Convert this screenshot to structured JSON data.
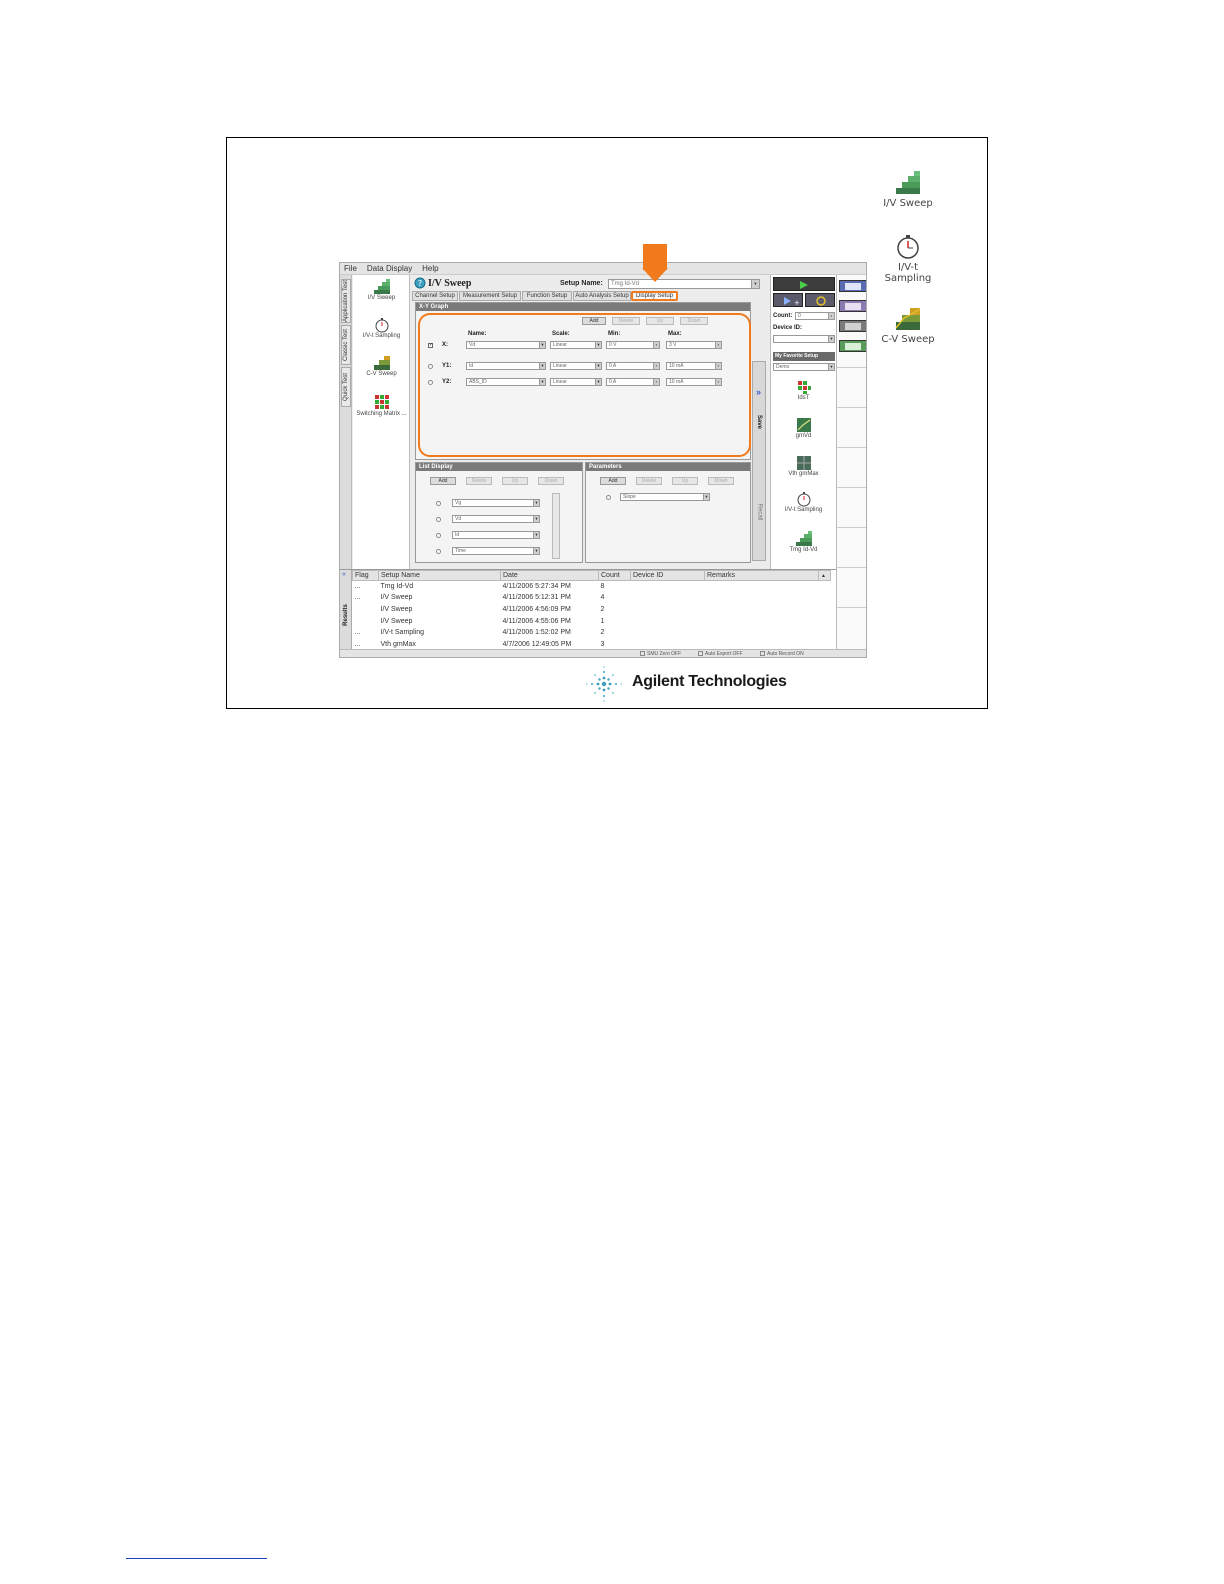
{
  "desktop_icons": [
    {
      "label": "I/V Sweep",
      "icon": "iv-sweep-icon"
    },
    {
      "label": "I/V-t\nSampling",
      "icon": "stopwatch-icon"
    },
    {
      "label": "C-V Sweep",
      "icon": "cv-sweep-icon"
    }
  ],
  "menu": [
    "File",
    "Data Display",
    "Help"
  ],
  "vertical_tabs": [
    "Application Test",
    "Classic Test",
    "Quick Test"
  ],
  "left_panel": [
    {
      "label": "I/V Sweep",
      "icon": "iv-sweep-icon"
    },
    {
      "label": "I/V-t Sampling",
      "icon": "stopwatch-icon"
    },
    {
      "label": "C-V Sweep",
      "icon": "cv-sweep-icon"
    },
    {
      "label": "Switching Matrix ...",
      "icon": "switching-matrix-icon"
    }
  ],
  "title": "I/V Sweep",
  "setup_name_label": "Setup Name:",
  "setup_name_value": "Tmg Id-Vd",
  "tabs": [
    "Channel Setup",
    "Measurement Setup",
    "Function Setup",
    "Auto Analysis Setup",
    "Display Setup"
  ],
  "xy_graph": {
    "header": "X-Y Graph",
    "buttons": [
      "Add",
      "Delete",
      "Up",
      "Down"
    ],
    "columns": [
      "Name:",
      "Scale:",
      "Min:",
      "Max:"
    ],
    "rows": [
      {
        "axis": "X:",
        "name": "Vd",
        "scale": "Linear",
        "min": "0 V",
        "max": "3 V"
      },
      {
        "axis": "Y1:",
        "name": "Id",
        "scale": "Linear",
        "min": "0 A",
        "max": "10 mA"
      },
      {
        "axis": "Y2:",
        "name": "ABS_ID",
        "scale": "Linear",
        "min": "0 A",
        "max": "10 mA"
      }
    ]
  },
  "list_display": {
    "header": "List Display",
    "buttons": [
      "Add",
      "Delete",
      "Up",
      "Down"
    ],
    "items": [
      "Vg",
      "Vd",
      "Id",
      "Time"
    ]
  },
  "parameters": {
    "header": "Parameters",
    "buttons": [
      "Add",
      "Delete",
      "Up",
      "Down"
    ],
    "items": [
      "Slope"
    ]
  },
  "right_panel": {
    "count_label": "Count:",
    "count_value": "0",
    "device_id_label": "Device ID:",
    "favorite_label": "My Favorite Setup",
    "favorite_value": "Demo",
    "save_tab": "Save",
    "recall_tab": "Recall",
    "items": [
      "IdsT",
      "gmVd",
      "Vth gmMax",
      "I/V-t Sampling",
      "Tmg Id-Vd"
    ]
  },
  "results": {
    "tab": "Results",
    "columns": [
      "Flag",
      "Setup Name",
      "Date",
      "Count",
      "Device ID",
      "Remarks"
    ],
    "rows": [
      {
        "flag": "...",
        "setup": "Tmg Id-Vd",
        "date": "4/11/2006 5:27:34 PM",
        "count": "8",
        "device": "",
        "remarks": ""
      },
      {
        "flag": "...",
        "setup": "I/V Sweep",
        "date": "4/11/2006 5:12:31 PM",
        "count": "4",
        "device": "",
        "remarks": ""
      },
      {
        "flag": "",
        "setup": "I/V Sweep",
        "date": "4/11/2006 4:56:09 PM",
        "count": "2",
        "device": "",
        "remarks": ""
      },
      {
        "flag": "",
        "setup": "I/V Sweep",
        "date": "4/11/2006 4:55:06 PM",
        "count": "1",
        "device": "",
        "remarks": ""
      },
      {
        "flag": "...",
        "setup": "I/V-t Sampling",
        "date": "4/11/2006 1:52:02 PM",
        "count": "2",
        "device": "",
        "remarks": ""
      },
      {
        "flag": "...",
        "setup": "Vth gmMax",
        "date": "4/7/2006 12:49:05 PM",
        "count": "3",
        "device": "",
        "remarks": ""
      }
    ]
  },
  "status": [
    "SMU Zero OFF",
    "Auto Export OFF",
    "Auto Record ON"
  ],
  "logo_text": "Agilent Technologies",
  "colors": {
    "accent": "#f07a1c",
    "panel_header": "#7a7a7a",
    "run_button": "#2e8b2e"
  }
}
